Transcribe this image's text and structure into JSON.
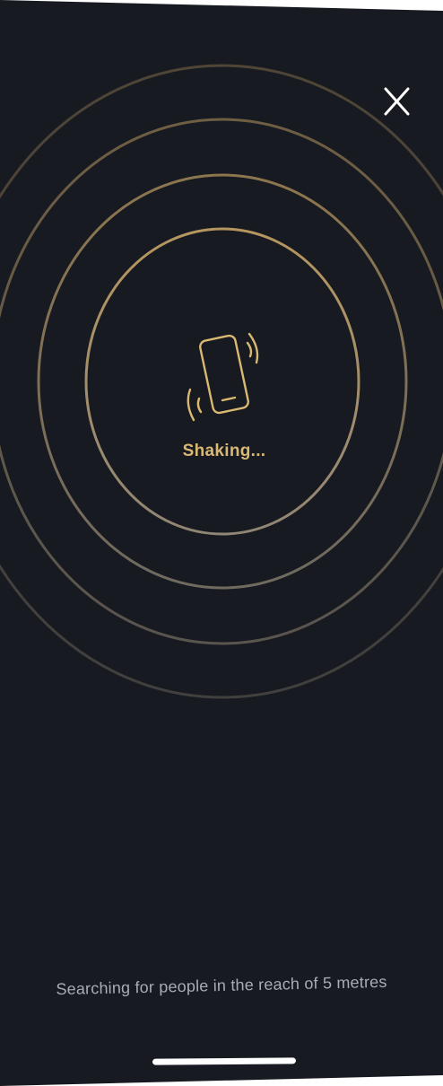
{
  "screen": {
    "background_color": "#171a21",
    "accent_color": "#d9b872",
    "ring_color": "#b89a5c"
  },
  "header": {
    "close_icon": "close-icon"
  },
  "shake": {
    "icon": "phone-vibrate-icon",
    "status_label": "Shaking..."
  },
  "footer": {
    "info_text": "Searching for people in the reach of 5 metres"
  }
}
